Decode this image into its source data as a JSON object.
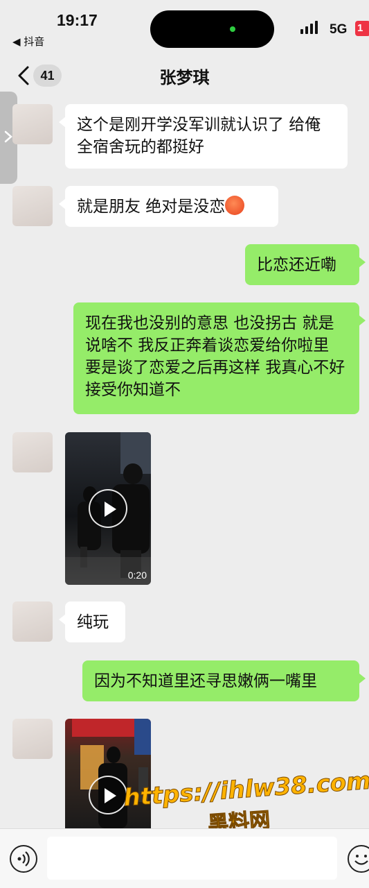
{
  "status_bar": {
    "time": "19:17",
    "back_app": "◀ 抖音",
    "network": "5G",
    "battery": "1"
  },
  "nav": {
    "unread_count": "41",
    "title": "张梦琪"
  },
  "messages": [
    {
      "side": "in",
      "type": "text",
      "text": "这个是刚开学没军训就认识了 给俺全宿舍玩的都挺好"
    },
    {
      "side": "in",
      "type": "text",
      "text": "就是朋友 绝对是没恋"
    },
    {
      "side": "out",
      "type": "text",
      "text": "比恋还近嘞"
    },
    {
      "side": "out",
      "type": "text",
      "text": "现在我也没别的意思 也没拐古 就是说啥不 我反正奔着谈恋爱给你啦里 要是谈了恋爱之后再这样 我真心不好接受你知道不"
    },
    {
      "side": "in",
      "type": "video",
      "duration": "0:20"
    },
    {
      "side": "in",
      "type": "text",
      "text": "纯玩"
    },
    {
      "side": "out",
      "type": "text",
      "text": "因为不知道里还寻思嫩俩一嘴里"
    },
    {
      "side": "in",
      "type": "video",
      "duration": ""
    }
  ],
  "watermark": {
    "url": "https://ihlw38.com",
    "text": "黑料网"
  },
  "icons": {
    "nav_back": "chevron-left-icon",
    "voice": "voice-icon",
    "emoji": "emoji-icon",
    "play": "play-icon"
  }
}
